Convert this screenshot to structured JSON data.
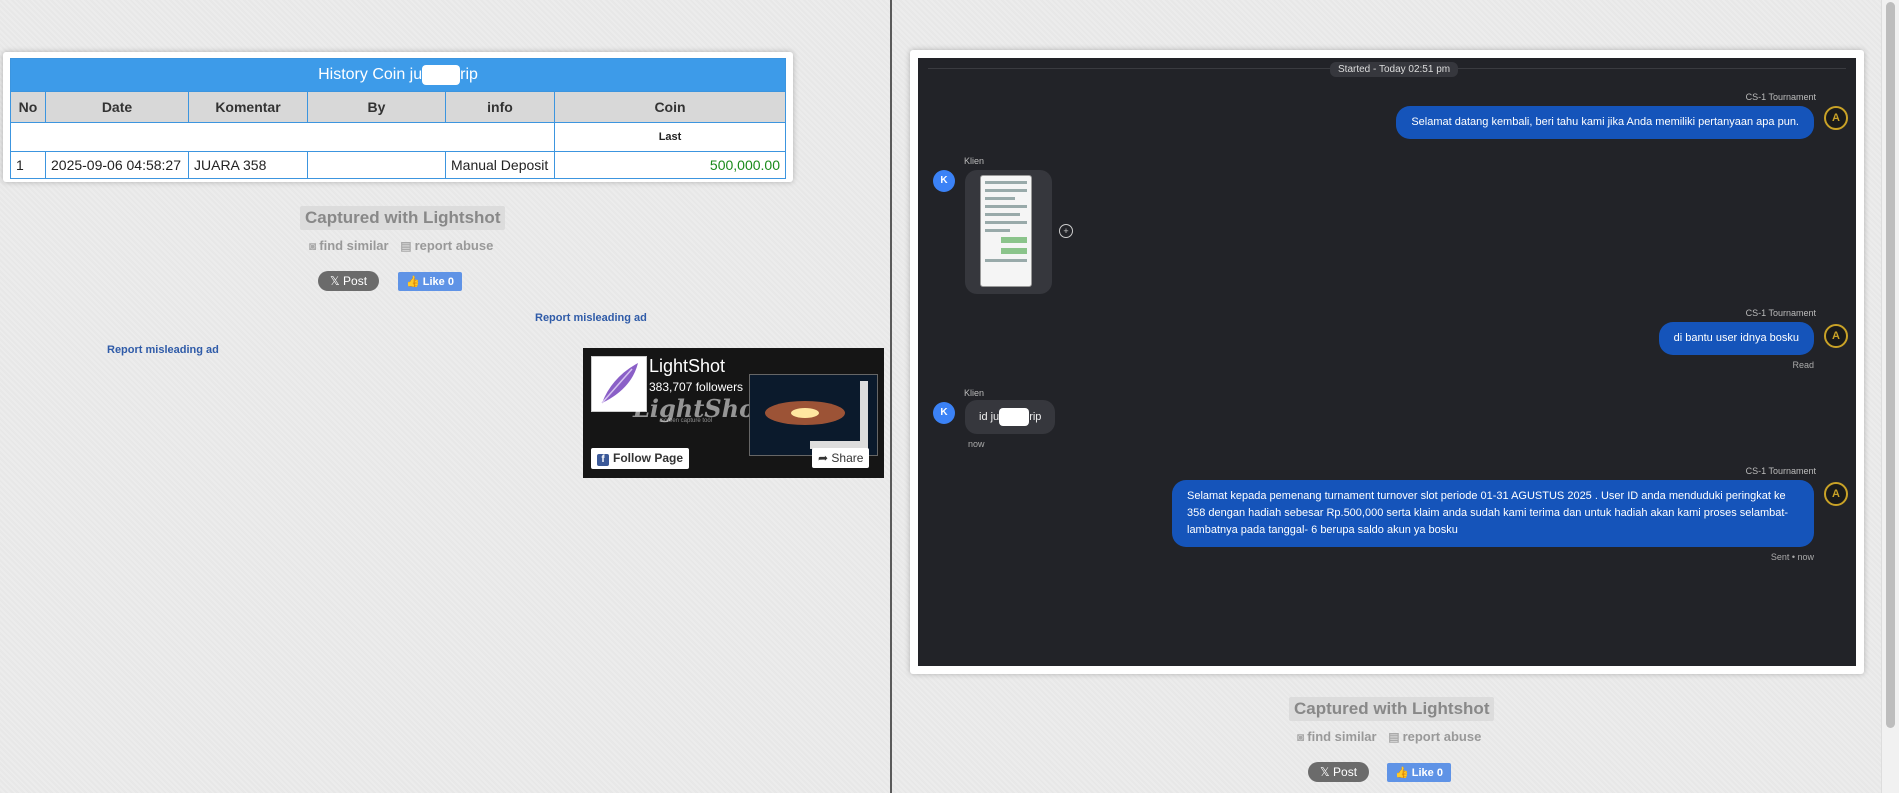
{
  "left": {
    "table": {
      "title_prefix": "History Coin ju",
      "title_suffix": "rip",
      "headers": [
        "No",
        "Date",
        "Komentar",
        "By",
        "info",
        "Coin"
      ],
      "subheader_last": "Last",
      "row": {
        "no": "1",
        "date": "2025-09-06 04:58:27",
        "komentar": "JUARA 358",
        "by": "",
        "info": "Manual Deposit",
        "coin": "500,000.00"
      }
    },
    "captured": "Captured with Lightshot",
    "find_similar": "find similar",
    "report_abuse": "report abuse",
    "post": "Post",
    "like": "Like 0",
    "report_ad_1": "Report misleading ad",
    "report_ad_2": "Report misleading ad",
    "fb_widget": {
      "page_name": "LightShot",
      "followers": "383,707 followers",
      "brand": "LightShot",
      "tagline": "screen capture tool",
      "follow": "Follow Page",
      "share": "Share"
    }
  },
  "right": {
    "chat": {
      "started": "Started - Today 02:51 pm",
      "messages": [
        {
          "sender": "CS-1 Tournament",
          "text": "Selamat datang kembali, beri tahu kami jika Anda memiliki pertanyaan apa pun."
        },
        {
          "sender": "Klien",
          "text": ""
        },
        {
          "sender": "CS-1 Tournament",
          "text": "di bantu user idnya bosku",
          "status": "Read"
        },
        {
          "sender": "Klien",
          "text_prefix": "id ju",
          "text_suffix": "rip",
          "time": "now"
        },
        {
          "sender": "CS-1 Tournament",
          "text": "Selamat kepada pemenang turnament turnover slot periode 01-31 AGUSTUS 2025 . User ID anda menduduki peringkat ke 358 dengan hadiah sebesar Rp.500,000 serta klaim anda sudah kami terima dan untuk hadiah akan kami proses selambat-lambatnya pada tanggal- 6 berupa saldo akun ya bosku",
          "status": "Sent • now"
        }
      ],
      "client_initial": "K"
    },
    "captured": "Captured with Lightshot",
    "find_similar": "find similar",
    "report_abuse": "report abuse",
    "post": "Post",
    "like": "Like 0"
  },
  "colors": {
    "table_header": "#3d9be9",
    "agent_bubble": "#1554ba",
    "chat_bg": "#222328",
    "coin_green": "#1a8a1a"
  }
}
